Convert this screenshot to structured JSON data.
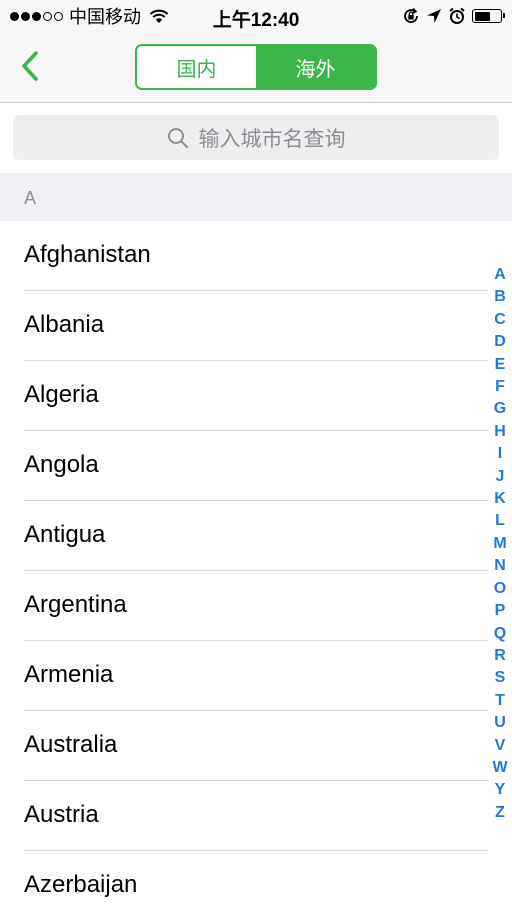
{
  "status_bar": {
    "carrier": "中国移动",
    "time": "上午12:40",
    "signal_bars_filled": 3,
    "signal_bars_total": 5,
    "battery_level": 0.65
  },
  "nav": {
    "back_icon": "chevron-left-icon",
    "segments": [
      "国内",
      "海外"
    ],
    "active_segment": "海外"
  },
  "search": {
    "placeholder": "输入城市名查询",
    "icon": "search-icon"
  },
  "section": {
    "header": "A"
  },
  "countries": [
    "Afghanistan",
    "Albania",
    "Algeria",
    "Angola",
    "Antigua",
    "Argentina",
    "Armenia",
    "Australia",
    "Austria",
    "Azerbaijan"
  ],
  "index_letters": [
    "A",
    "B",
    "C",
    "D",
    "E",
    "F",
    "G",
    "H",
    "I",
    "J",
    "K",
    "L",
    "M",
    "N",
    "O",
    "P",
    "Q",
    "R",
    "S",
    "T",
    "U",
    "V",
    "W",
    "Y",
    "Z"
  ],
  "colors": {
    "accent_green": "#3cb54a",
    "index_blue": "#1f7ae0",
    "section_bg": "#efeff4"
  }
}
